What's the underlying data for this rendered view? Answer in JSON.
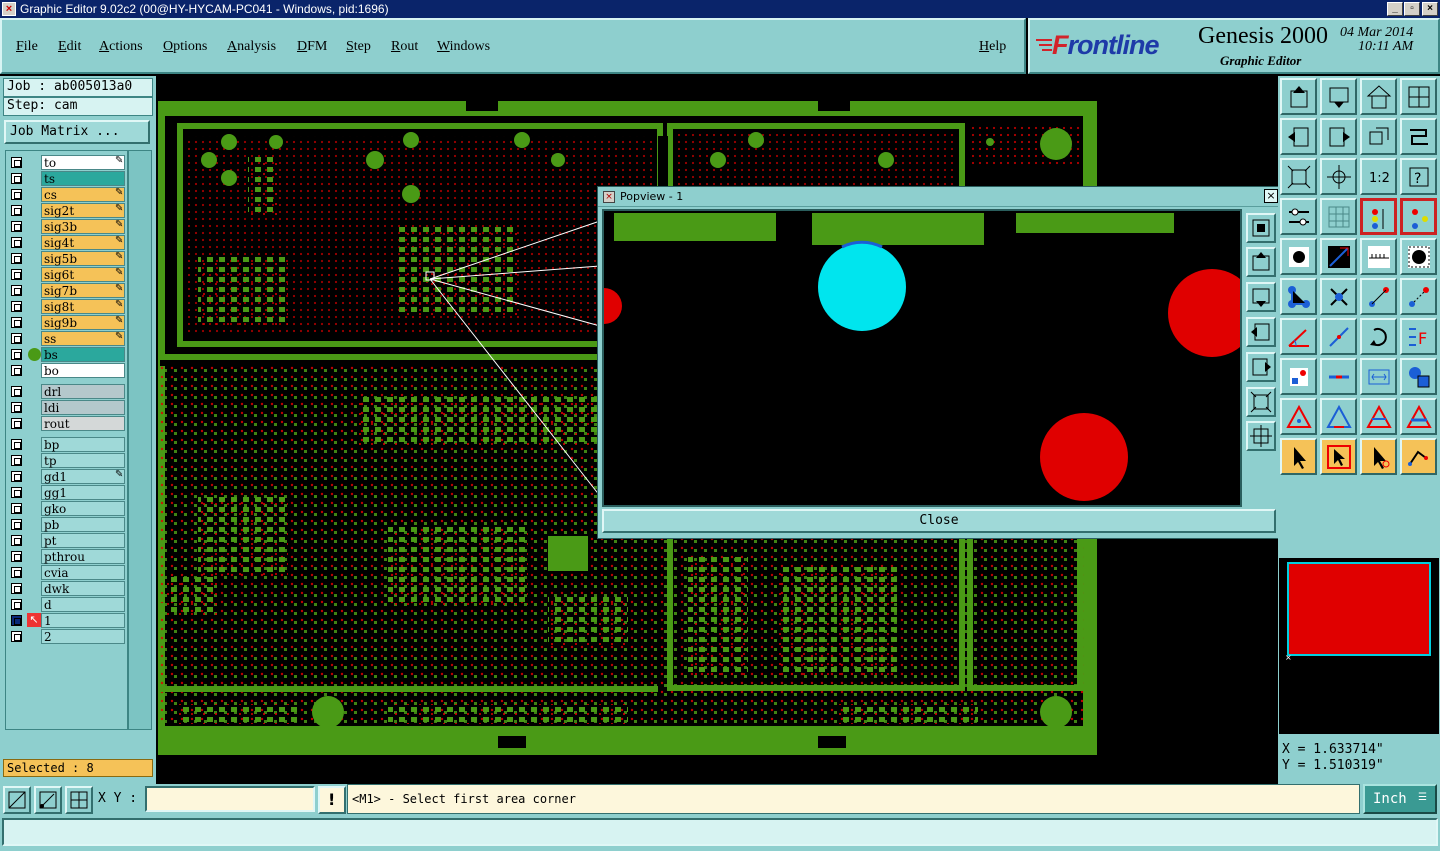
{
  "window": {
    "title": "Graphic Editor 9.02c2 (00@HY-HYCAM-PC041 - Windows, pid:1696)"
  },
  "menu": {
    "items": [
      "File",
      "Edit",
      "Actions",
      "Options",
      "Analysis",
      "DFM",
      "Step",
      "Rout",
      "Windows"
    ],
    "help": "Help"
  },
  "brand": {
    "logo_front": "F",
    "logo_rest": "rontline",
    "product": "Genesis 2000",
    "subtitle": "Graphic Editor",
    "date": "04 Mar 2014",
    "time": "10:11 AM"
  },
  "job": {
    "job_label": "Job : ab005013a0",
    "step_label": "Step: cam",
    "matrix_button": "Job Matrix ..."
  },
  "layers": [
    {
      "name": "to",
      "color": "#ffffff",
      "pen": true
    },
    {
      "name": "ts",
      "color": "#2ba89d",
      "pen": false
    },
    {
      "name": "cs",
      "color": "#f5c258",
      "pen": true
    },
    {
      "name": "sig2t",
      "color": "#f5c258",
      "pen": true
    },
    {
      "name": "sig3b",
      "color": "#f5c258",
      "pen": true
    },
    {
      "name": "sig4t",
      "color": "#f5c258",
      "pen": true
    },
    {
      "name": "sig5b",
      "color": "#f5c258",
      "pen": true
    },
    {
      "name": "sig6t",
      "color": "#f5c258",
      "pen": true
    },
    {
      "name": "sig7b",
      "color": "#f5c258",
      "pen": true
    },
    {
      "name": "sig8t",
      "color": "#f5c258",
      "pen": true
    },
    {
      "name": "sig9b",
      "color": "#f5c258",
      "pen": true
    },
    {
      "name": "ss",
      "color": "#f5c258",
      "pen": true
    },
    {
      "name": "bs",
      "color": "#2ba89d",
      "pen": false,
      "active": true
    },
    {
      "name": "bo",
      "color": "#ffffff",
      "pen": false
    },
    {
      "name": "drl",
      "color": "#b4c8cc",
      "pen": false,
      "gap": true
    },
    {
      "name": "ldi",
      "color": "#b4c8cc",
      "pen": false
    },
    {
      "name": "rout",
      "color": "#d4d8d8",
      "pen": false
    },
    {
      "name": "bp",
      "color": "#9fd9d8",
      "pen": false,
      "gap": true
    },
    {
      "name": "tp",
      "color": "#9fd9d8",
      "pen": false
    },
    {
      "name": "gd1",
      "color": "#9fd9d8",
      "pen": true
    },
    {
      "name": "gg1",
      "color": "#9fd9d8",
      "pen": false
    },
    {
      "name": "gko",
      "color": "#9fd9d8",
      "pen": false
    },
    {
      "name": "pb",
      "color": "#9fd9d8",
      "pen": false
    },
    {
      "name": "pt",
      "color": "#9fd9d8",
      "pen": false
    },
    {
      "name": "pthrou",
      "color": "#9fd9d8",
      "pen": false
    },
    {
      "name": "cvia",
      "color": "#9fd9d8",
      "pen": false
    },
    {
      "name": "dwk",
      "color": "#9fd9d8",
      "pen": false
    },
    {
      "name": "d",
      "color": "#9fd9d8",
      "pen": false
    },
    {
      "name": "1",
      "color": "#9fd9d8",
      "pen": false,
      "work": true
    },
    {
      "name": "2",
      "color": "#9fd9d8",
      "pen": false
    }
  ],
  "selected": "Selected : 8",
  "popview": {
    "title": "Popview - 1",
    "close": "Close"
  },
  "coords": {
    "x": "X = 1.633714\"",
    "y": "Y = 1.510319\""
  },
  "bottom": {
    "xy_label": "X Y :",
    "xy_value": "",
    "prompt": "<M1> - Select first area corner",
    "unit": "Inch"
  },
  "colors": {
    "panel": "#8ecfce",
    "board": "#4a9a16",
    "pad": "#e00000",
    "highlight": "#00e5ee"
  }
}
